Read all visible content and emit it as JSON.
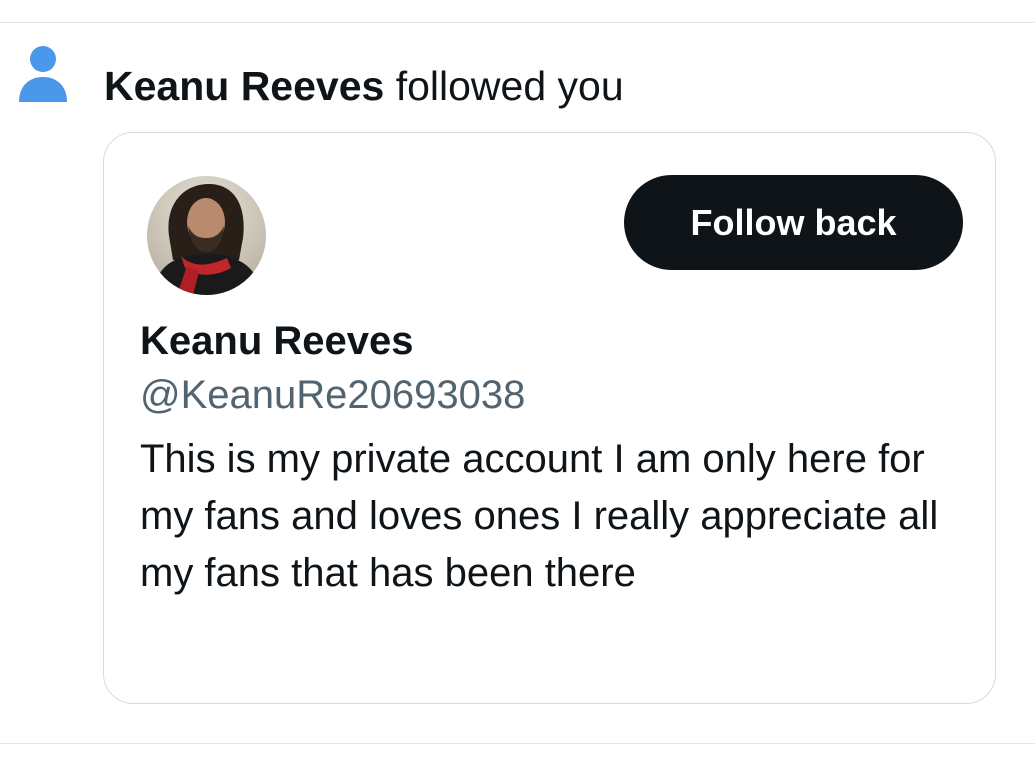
{
  "notification": {
    "icon": "person-icon",
    "actor": "Keanu Reeves",
    "action": " followed you",
    "icon_color": "#4a98ea"
  },
  "profile_card": {
    "avatar": "profile-photo",
    "display_name": "Keanu Reeves",
    "handle": "@KeanuRe20693038",
    "bio": "This is my private account I am only here for my fans and loves ones I really appreciate all my fans that has been there",
    "follow_button_label": "Follow back",
    "button_color": "#0f1419"
  }
}
